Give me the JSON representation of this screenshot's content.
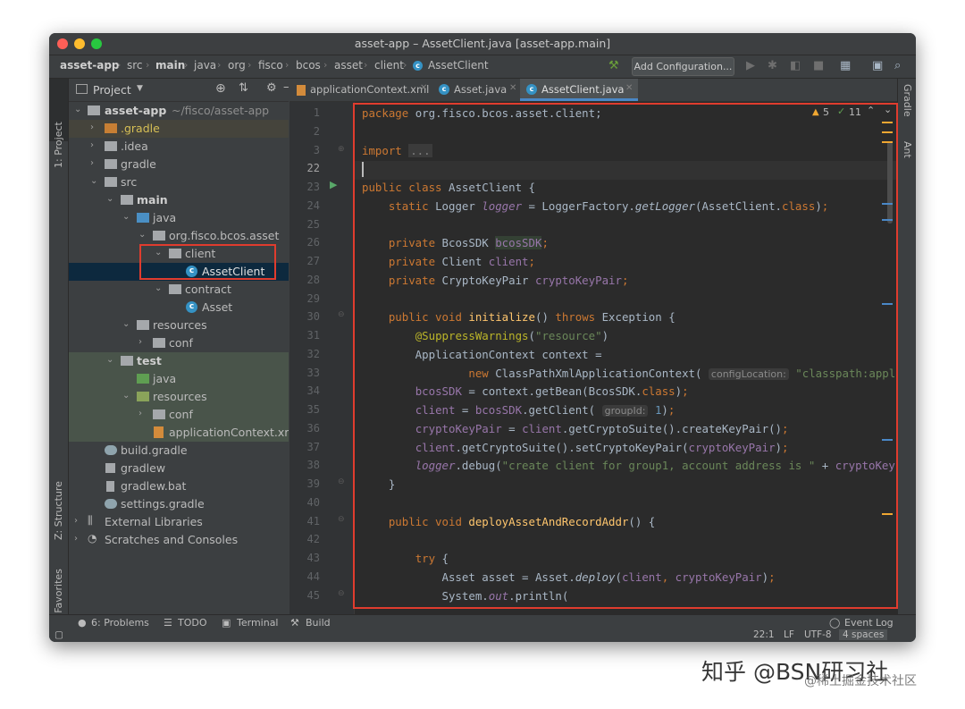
{
  "window": {
    "title": "asset-app – AssetClient.java [asset-app.main]"
  },
  "navbar": {
    "breadcrumbs": [
      "asset-app",
      "src",
      "main",
      "java",
      "org",
      "fisco",
      "bcos",
      "asset",
      "client",
      "AssetClient"
    ],
    "add_configuration": "Add Configuration..."
  },
  "left_strip": {
    "project": "1: Project",
    "structure": "Z: Structure",
    "favorites": "2: Favorites"
  },
  "right_strip": {
    "gradle": "Gradle",
    "ant": "Ant"
  },
  "project_panel": {
    "title": "Project",
    "items": [
      {
        "label": "asset-app",
        "suffix": "~/fisco/asset-app"
      },
      {
        "label": ".gradle"
      },
      {
        "label": ".idea"
      },
      {
        "label": "gradle"
      },
      {
        "label": "src"
      },
      {
        "label": "main"
      },
      {
        "label": "java"
      },
      {
        "label": "org.fisco.bcos.asset"
      },
      {
        "label": "client"
      },
      {
        "label": "AssetClient"
      },
      {
        "label": "contract"
      },
      {
        "label": "Asset"
      },
      {
        "label": "resources"
      },
      {
        "label": "conf"
      },
      {
        "label": "test"
      },
      {
        "label": "java"
      },
      {
        "label": "resources"
      },
      {
        "label": "conf"
      },
      {
        "label": "applicationContext.xml"
      },
      {
        "label": "build.gradle"
      },
      {
        "label": "gradlew"
      },
      {
        "label": "gradlew.bat"
      },
      {
        "label": "settings.gradle"
      },
      {
        "label": "External Libraries"
      },
      {
        "label": "Scratches and Consoles"
      }
    ]
  },
  "tabs": [
    {
      "label": "applicationContext.xml"
    },
    {
      "label": "Asset.java"
    },
    {
      "label": "AssetClient.java"
    }
  ],
  "editor": {
    "warnings": "5",
    "checks": "11",
    "line_numbers": [
      "1",
      "2",
      "3",
      "22",
      "23",
      "24",
      "25",
      "26",
      "27",
      "28",
      "29",
      "30",
      "31",
      "32",
      "33",
      "34",
      "35",
      "36",
      "37",
      "38",
      "39",
      "40",
      "41",
      "42",
      "43",
      "44",
      "45"
    ],
    "hints": {
      "config_location": "configLocation:",
      "group_id": "groupId:"
    }
  },
  "bottom_tools": {
    "problems": "6: Problems",
    "todo": "TODO",
    "terminal": "Terminal",
    "build": "Build",
    "event_log": "Event Log"
  },
  "status_bar": {
    "position": "22:1",
    "line_sep": "LF",
    "encoding": "UTF-8",
    "indent": "4 spaces"
  },
  "watermark": {
    "line1": "知乎 @BSN研习社",
    "line2": "@稀土掘金技术社区"
  },
  "colors": {
    "highlight_box": "#e03c2e",
    "selection": "#0d293e",
    "keyword": "#cc7832",
    "field": "#9876aa",
    "string": "#6a8759",
    "method": "#ffc66d"
  }
}
